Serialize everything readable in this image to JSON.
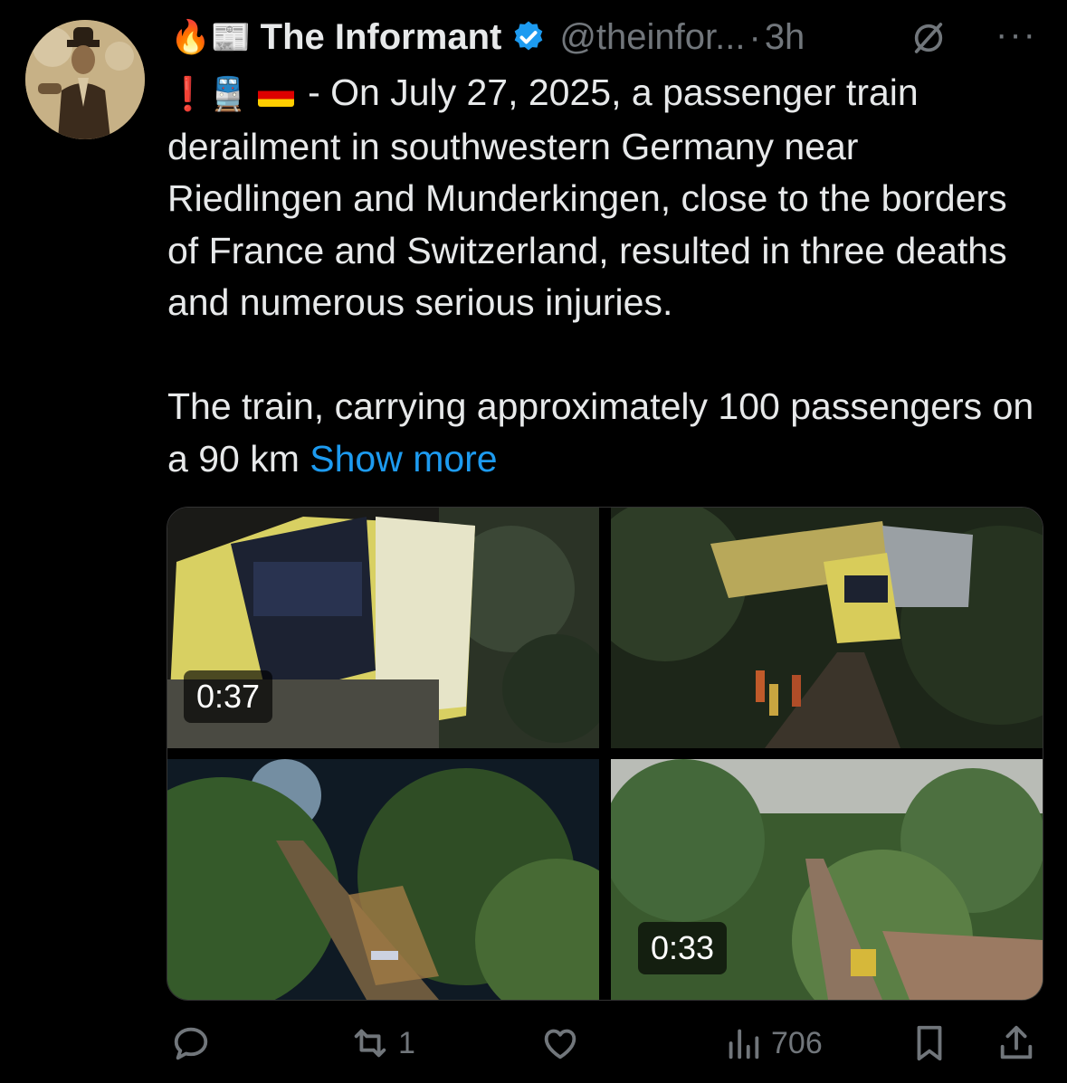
{
  "author": {
    "name": "The Informant",
    "handle": "@theinfor...",
    "time": "3h",
    "prefix_emoji": "🔥📰",
    "verified": true
  },
  "post": {
    "line1_emoji": "❗🚆",
    "paragraph1": "- On July 27, 2025, a passenger train derailment in southwestern Germany near Riedlingen and Munderkingen, close to the borders of France and Switzerland, resulted in three deaths and numerous serious injuries.",
    "paragraph2": "The train, carrying approximately 100 passengers on a 90 km",
    "show_more": "Show more"
  },
  "media": [
    {
      "kind": "video",
      "duration": "0:37"
    },
    {
      "kind": "image"
    },
    {
      "kind": "image"
    },
    {
      "kind": "video",
      "duration": "0:33"
    }
  ],
  "actions": {
    "replies": "",
    "reposts": "1",
    "likes": "",
    "views": "706"
  },
  "colors": {
    "background": "#000000",
    "text": "#e7e9ea",
    "muted": "#71767b",
    "link": "#1d9bf0"
  }
}
